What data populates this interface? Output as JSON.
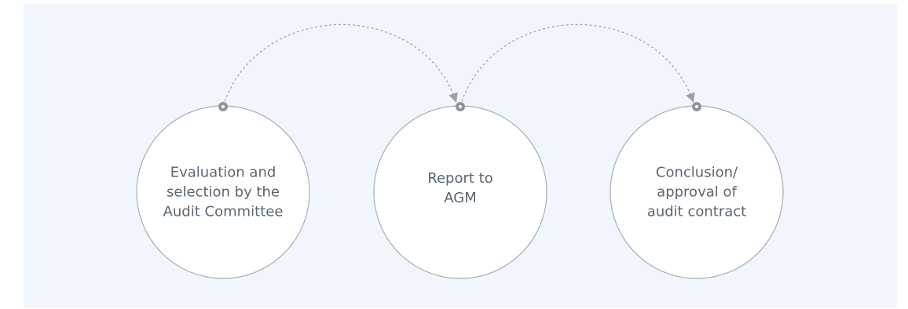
{
  "steps": [
    {
      "label": "Evaluation and\nselection by the\nAudit Committee"
    },
    {
      "label": "Report to\nAGM"
    },
    {
      "label": "Conclusion/\napproval of\naudit contract"
    }
  ],
  "colors": {
    "background": "#f1f6fd",
    "circle_fill": "#ffffff",
    "circle_stroke": "#a8adb2",
    "connector": "#9aa0a6",
    "node": "#8f959b",
    "text": "#5b6670"
  }
}
